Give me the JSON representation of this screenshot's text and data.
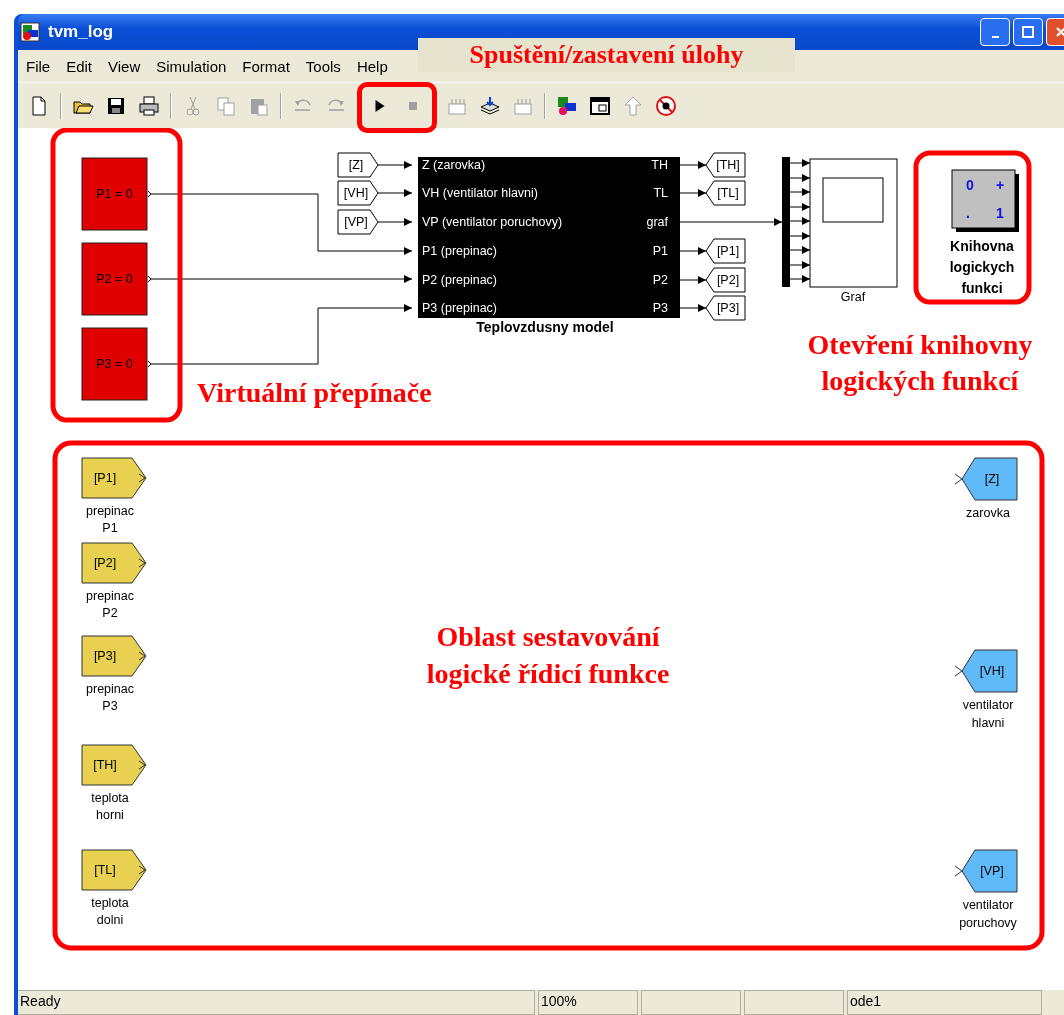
{
  "window": {
    "title": "tvm_log"
  },
  "menu": [
    "File",
    "Edit",
    "View",
    "Simulation",
    "Format",
    "Tools",
    "Help"
  ],
  "toolbar": [
    [
      {
        "kind": "new",
        "disabled": false
      }
    ],
    [
      {
        "kind": "open",
        "disabled": false
      },
      {
        "kind": "save",
        "disabled": false
      },
      {
        "kind": "print",
        "disabled": false
      }
    ],
    [
      {
        "kind": "cut",
        "disabled": true
      },
      {
        "kind": "copy",
        "disabled": true
      },
      {
        "kind": "paste",
        "disabled": true
      }
    ],
    [
      {
        "kind": "undo",
        "disabled": true
      },
      {
        "kind": "redo",
        "disabled": true
      }
    ],
    [
      {
        "kind": "play",
        "disabled": false
      },
      {
        "kind": "stop",
        "disabled": true
      }
    ],
    [
      {
        "kind": "build",
        "disabled": true
      },
      {
        "kind": "update",
        "disabled": false
      },
      {
        "kind": "build",
        "disabled": true
      }
    ],
    [
      {
        "kind": "library",
        "disabled": false
      },
      {
        "kind": "explorer",
        "disabled": false
      },
      {
        "kind": "up",
        "disabled": true
      },
      {
        "kind": "debug",
        "disabled": false
      }
    ]
  ],
  "annotations": {
    "run_stop": "Spuštění/zastavení úlohy",
    "switches": "Virtuální přepínače",
    "library": [
      "Otevření knihovny",
      "logických funkcí"
    ],
    "area": [
      "Oblast sestavování",
      "logické řídicí funkce"
    ]
  },
  "switches": [
    {
      "label": "P1 = 0"
    },
    {
      "label": "P2 = 0"
    },
    {
      "label": "P3 = 0"
    }
  ],
  "model": {
    "name": "Teplovzdusny model",
    "inputs": [
      {
        "port": "Z (zarovka)",
        "tag": "[Z]"
      },
      {
        "port": "VH (ventilator hlavni)",
        "tag": "[VH]"
      },
      {
        "port": "VP (ventilator poruchovy)",
        "tag": "[VP]"
      },
      {
        "port": "P1 (prepinac)"
      },
      {
        "port": "P2 (prepinac)"
      },
      {
        "port": "P3 (prepinac)"
      }
    ],
    "outputs": [
      {
        "port": "TH",
        "tag": "[TH]"
      },
      {
        "port": "TL",
        "tag": "[TL]"
      },
      {
        "port": "graf"
      },
      {
        "port": "P1",
        "tag": "[P1]"
      },
      {
        "port": "P2",
        "tag": "[P2]"
      },
      {
        "port": "P3",
        "tag": "[P3]"
      }
    ]
  },
  "scope": {
    "name": "Graf"
  },
  "library": {
    "symbols": [
      "0",
      "+",
      ".",
      "1"
    ],
    "name": [
      "Knihovna",
      "logickych",
      "funkci"
    ]
  },
  "from_blocks": [
    {
      "tag": "[P1]",
      "name": [
        "prepinac",
        "P1"
      ]
    },
    {
      "tag": "[P2]",
      "name": [
        "prepinac",
        "P2"
      ]
    },
    {
      "tag": "[P3]",
      "name": [
        "prepinac",
        "P3"
      ]
    },
    {
      "tag": "[TH]",
      "name": [
        "teplota",
        "horni"
      ]
    },
    {
      "tag": "[TL]",
      "name": [
        "teplota",
        "dolni"
      ]
    }
  ],
  "goto_blocks": [
    {
      "tag": "[Z]",
      "name": [
        "zarovka"
      ]
    },
    {
      "tag": "[VH]",
      "name": [
        "ventilator",
        "hlavni"
      ]
    },
    {
      "tag": "[VP]",
      "name": [
        "ventilator",
        "poruchovy"
      ]
    }
  ],
  "status_bar": {
    "status": "Ready",
    "zoom": "100%",
    "solver": "ode1"
  }
}
